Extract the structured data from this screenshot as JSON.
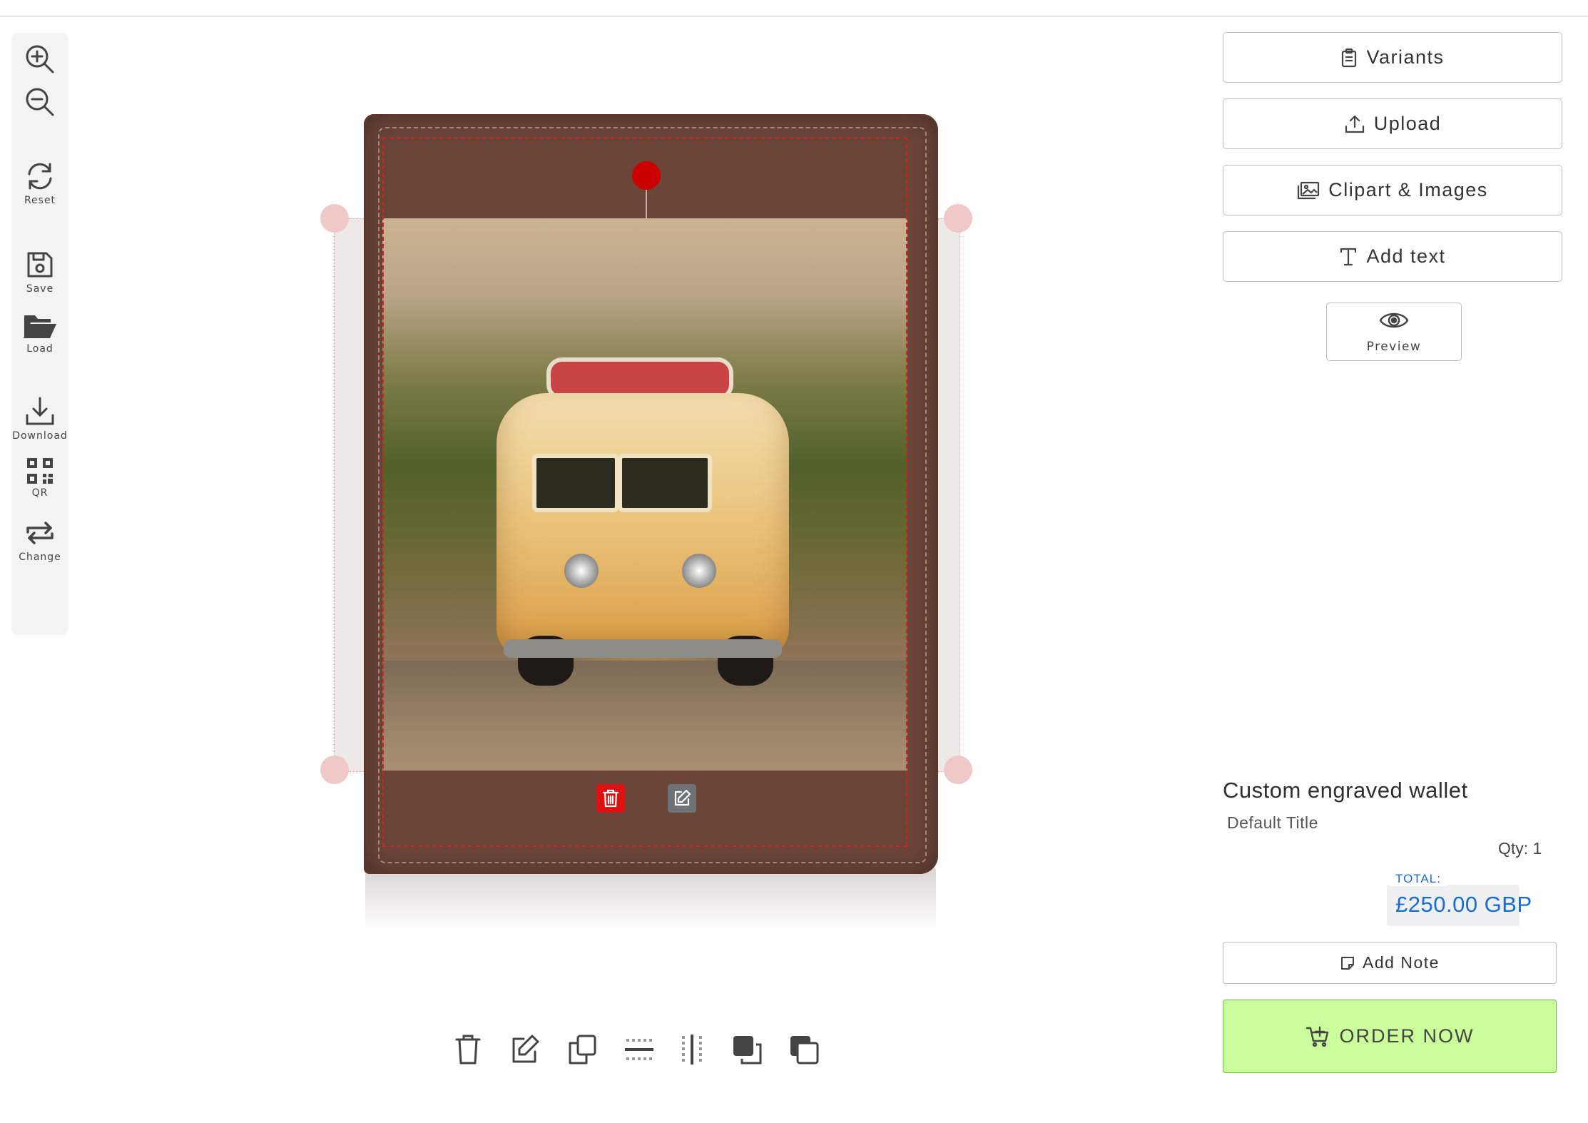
{
  "toolbar": {
    "zoom_in": "zoom-in",
    "zoom_out": "zoom-out",
    "reset_label": "Reset",
    "save_label": "Save",
    "load_label": "Load",
    "download_label": "Download",
    "qr_label": "QR",
    "change_label": "Change"
  },
  "panel": {
    "variants_label": "Variants",
    "upload_label": "Upload",
    "clipart_label": "Clipart & Images",
    "add_text_label": "Add text",
    "preview_label": "Preview"
  },
  "product": {
    "title": "Custom engraved wallet",
    "variant": "Default Title",
    "qty": "Qty: 1",
    "total_label": "TOTAL:",
    "total_value": "£250.00 GBP"
  },
  "actions": {
    "add_note_label": "Add Note",
    "order_label": "ORDER NOW"
  },
  "colors": {
    "accent_blue": "#1a6ad6",
    "order_green": "#ccfd9c",
    "delete_red": "#cc0000",
    "wallet_brown": "#6b4538"
  },
  "icons": {
    "bottom_tools": [
      "trash-icon",
      "edit-icon",
      "duplicate-icon",
      "align-horizontal-center-icon",
      "align-vertical-center-icon",
      "bring-forward-icon",
      "send-backward-icon"
    ]
  }
}
